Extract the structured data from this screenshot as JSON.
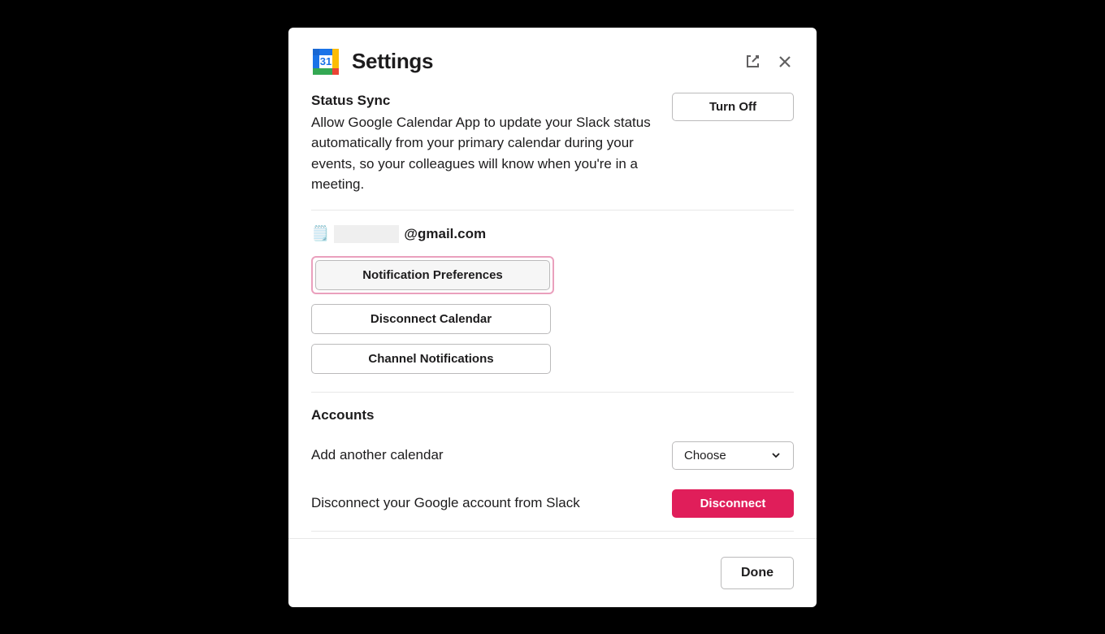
{
  "header": {
    "title": "Settings",
    "app_icon_date": "31"
  },
  "status_sync": {
    "title": "Status Sync",
    "description": "Allow Google Calendar App to update your Slack status automatically from your primary calendar during your events, so your colleagues will know when you're in a meeting.",
    "turn_off_label": "Turn Off"
  },
  "account": {
    "emoji": "🗒️",
    "email_suffix": "@gmail.com"
  },
  "buttons": {
    "notification_preferences": "Notification Preferences",
    "disconnect_calendar": "Disconnect Calendar",
    "channel_notifications": "Channel Notifications"
  },
  "accounts_section": {
    "title": "Accounts",
    "add_calendar_label": "Add another calendar",
    "choose_label": "Choose",
    "disconnect_label": "Disconnect your Google account from Slack",
    "disconnect_button": "Disconnect"
  },
  "footer": {
    "done_label": "Done"
  }
}
